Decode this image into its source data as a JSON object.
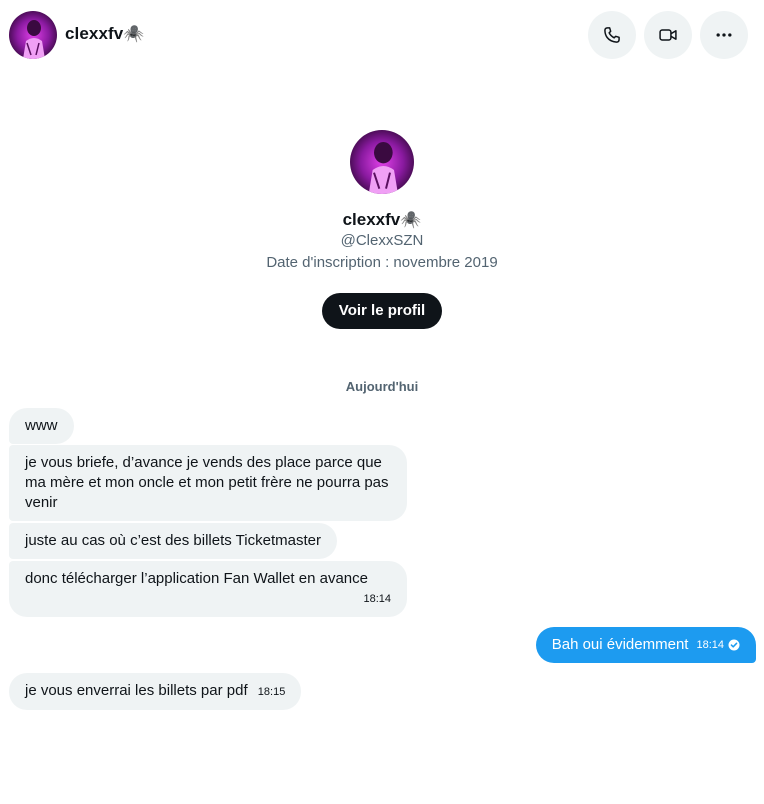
{
  "header": {
    "name": "clexxfv🕷️"
  },
  "profile": {
    "name": "clexxfv🕷️",
    "handle": "@ClexxSZN",
    "joined": "Date d'inscription : novembre 2019",
    "view_profile_label": "Voir le profil"
  },
  "day_separator": "Aujourd'hui",
  "messages": [
    {
      "direction": "in",
      "text": "www",
      "time": ""
    },
    {
      "direction": "in",
      "text": "je vous briefe, d’avance je vends des place parce que ma mère et mon oncle et mon petit frère ne pourra pas venir",
      "time": ""
    },
    {
      "direction": "in",
      "text": "juste au cas où c’est des billets Ticketmaster",
      "time": ""
    },
    {
      "direction": "in",
      "text": "donc télécharger l’application Fan Wallet en avance",
      "time": "18:14"
    },
    {
      "direction": "out",
      "text": "Bah oui évidemment",
      "time": "18:14",
      "status": "read"
    },
    {
      "direction": "in",
      "text": "je vous enverrai les billets par pdf",
      "time": "18:15"
    }
  ],
  "icons": {
    "call": "phone-icon",
    "video": "video-camera-icon",
    "more": "more-horizontal-icon",
    "read": "check-circle-icon"
  },
  "colors": {
    "accent": "#1d9bf0",
    "incoming_bubble": "#eff3f4",
    "dark_button": "#0f1419",
    "secondary_text": "#536471"
  }
}
